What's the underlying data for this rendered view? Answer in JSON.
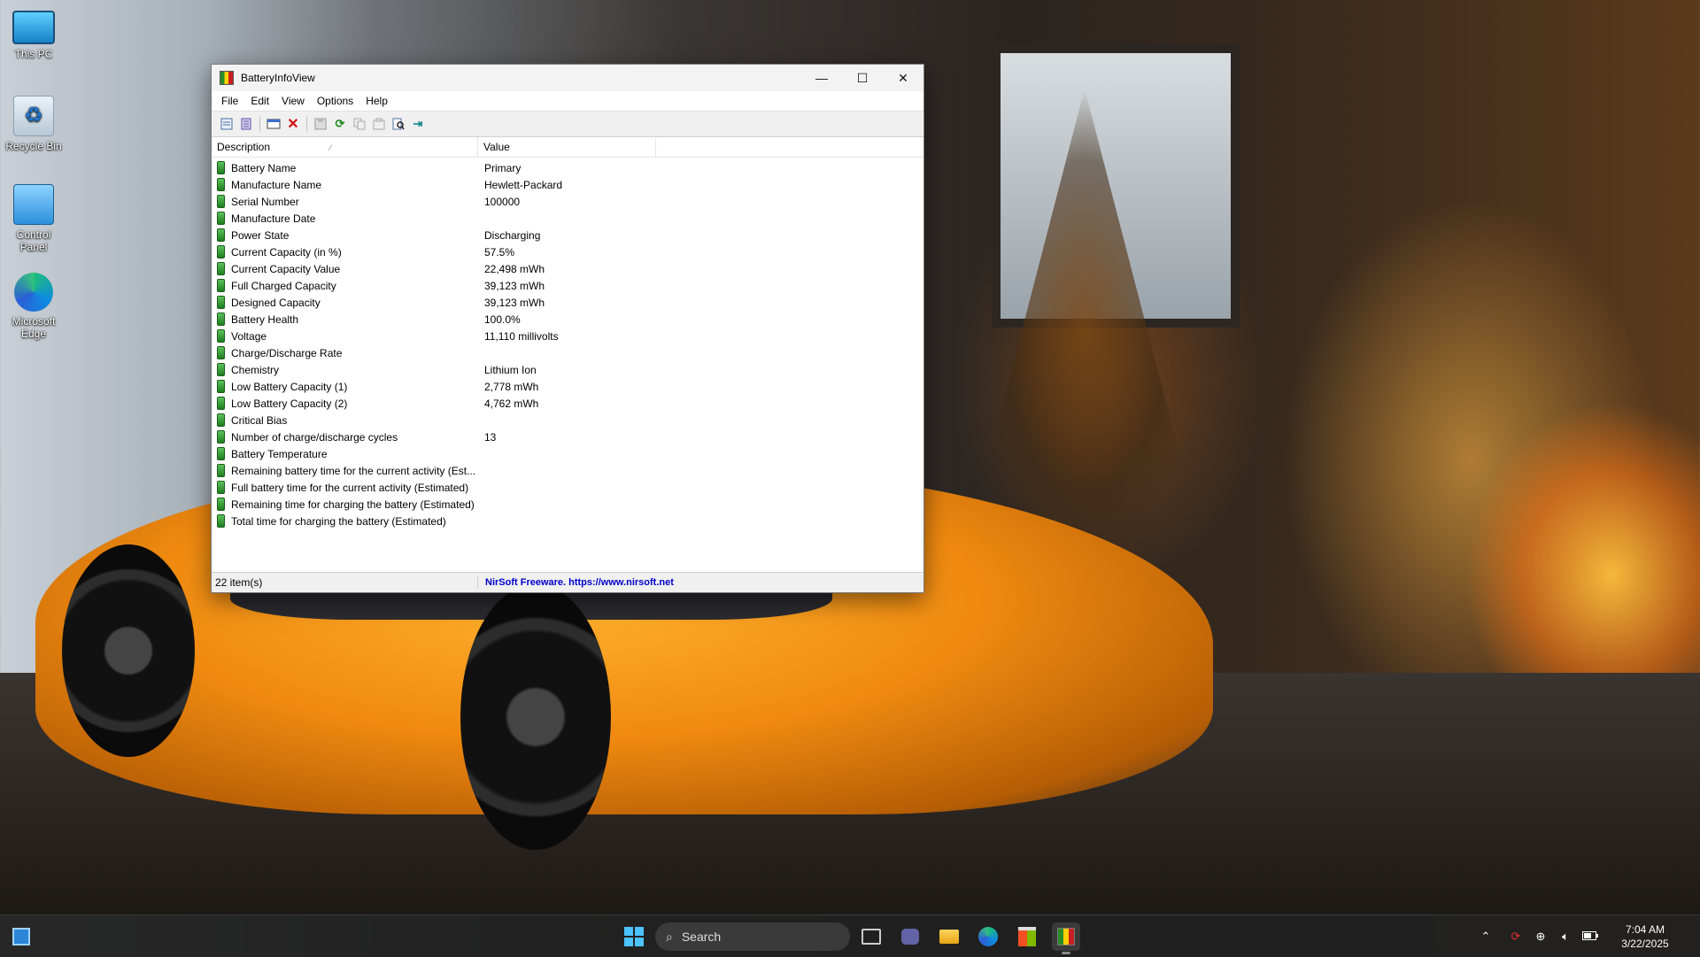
{
  "desktop": {
    "icons": [
      {
        "label": "This PC",
        "icon": "computer-icon"
      },
      {
        "label": "Recycle Bin",
        "icon": "recycle-bin-icon"
      },
      {
        "label": "Control Panel",
        "icon": "control-panel-icon"
      },
      {
        "label": "Microsoft Edge",
        "icon": "edge-icon"
      }
    ]
  },
  "window": {
    "title": "BatteryInfoView",
    "controls": {
      "minimize": "—",
      "maximize": "☐",
      "close": "✕"
    },
    "menu": [
      "File",
      "Edit",
      "View",
      "Options",
      "Help"
    ],
    "columns": {
      "description": "Description",
      "value": "Value"
    },
    "rows": [
      {
        "description": "Battery Name",
        "value": "Primary"
      },
      {
        "description": "Manufacture Name",
        "value": "Hewlett-Packard"
      },
      {
        "description": "Serial Number",
        "value": "100000"
      },
      {
        "description": "Manufacture Date",
        "value": ""
      },
      {
        "description": "Power State",
        "value": "Discharging"
      },
      {
        "description": "Current Capacity (in %)",
        "value": "57.5%"
      },
      {
        "description": "Current Capacity Value",
        "value": "22,498 mWh"
      },
      {
        "description": "Full Charged Capacity",
        "value": "39,123 mWh"
      },
      {
        "description": "Designed Capacity",
        "value": "39,123 mWh"
      },
      {
        "description": "Battery Health",
        "value": "100.0%"
      },
      {
        "description": "Voltage",
        "value": "11,110 millivolts"
      },
      {
        "description": "Charge/Discharge Rate",
        "value": ""
      },
      {
        "description": "Chemistry",
        "value": "Lithium Ion"
      },
      {
        "description": "Low Battery Capacity (1)",
        "value": "2,778 mWh"
      },
      {
        "description": "Low Battery Capacity (2)",
        "value": "4,762 mWh"
      },
      {
        "description": "Critical Bias",
        "value": ""
      },
      {
        "description": "Number of charge/discharge cycles",
        "value": "13"
      },
      {
        "description": "Battery Temperature",
        "value": ""
      },
      {
        "description": "Remaining battery time for the current activity (Est...",
        "value": ""
      },
      {
        "description": "Full battery time for the current activity (Estimated)",
        "value": ""
      },
      {
        "description": "Remaining time for charging the battery (Estimated)",
        "value": ""
      },
      {
        "description": "Total  time for charging the battery (Estimated)",
        "value": ""
      }
    ],
    "status": {
      "count": "22 item(s)",
      "link": "NirSoft Freeware. https://www.nirsoft.net"
    }
  },
  "taskbar": {
    "search_label": "Search",
    "clock_time": "7:04 AM",
    "clock_date": "3/22/2025"
  }
}
